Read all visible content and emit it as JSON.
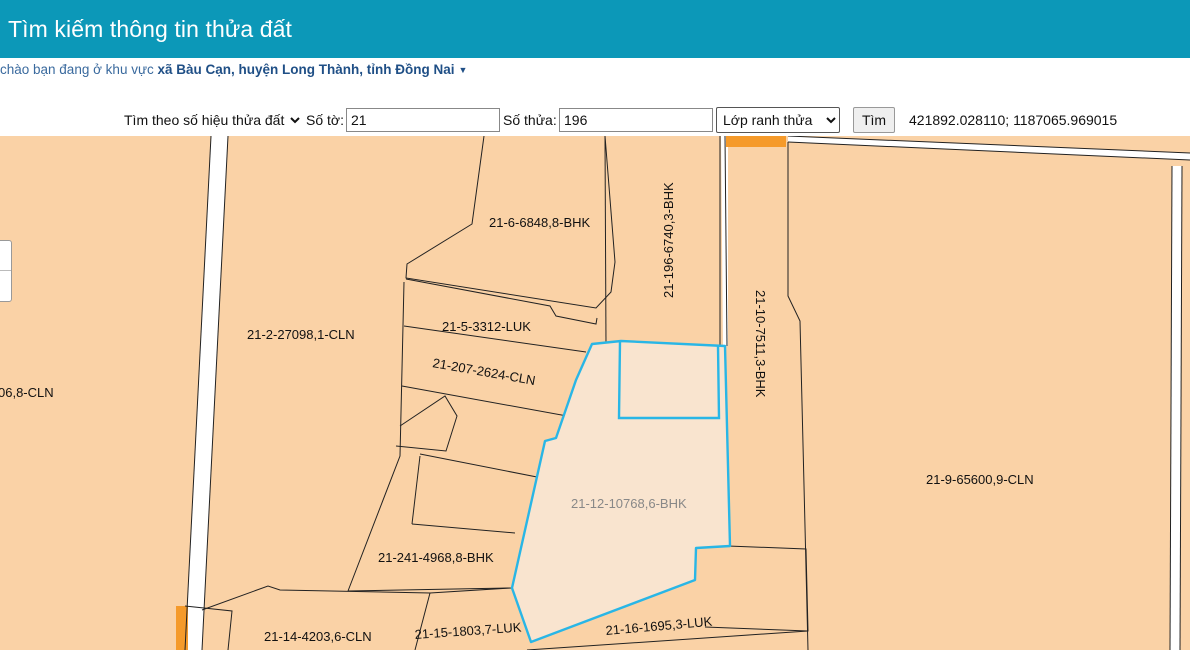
{
  "header": {
    "title": "Tìm kiếm thông tin thửa đất"
  },
  "greeting": {
    "prefix": "chào bạn đang ở khu vực ",
    "area": "xã Bàu Cạn, huyện Long Thành, tỉnh Đồng Nai"
  },
  "search": {
    "mode_options": [
      "Tìm theo số hiệu thửa đất"
    ],
    "sheet_label": "Số tờ:",
    "sheet_value": "21",
    "parcel_label": "Số thửa:",
    "parcel_value": "196",
    "layer_options": [
      "Lớp ranh thửa"
    ],
    "button_label": "Tìm",
    "coords": "421892.028110; 1187065.969015"
  },
  "map": {
    "parcel_labels": [
      "21-6-6848,8-BHK",
      "21-196-6740,3-BHK",
      "21-10-7511,3-BHK",
      "21-9-65600,9-CLN",
      "21-2-27098,1-CLN",
      "21-5-3312-LUK",
      "21-207-2624-CLN",
      "21-12-10768,6-BHK",
      "21-241-4968,8-BHK",
      "21-14-4203,6-CLN",
      "21-15-1803,7-LUK",
      "21-16-1695,3-LUK",
      "06,8-CLN"
    ],
    "colors": {
      "parcel_fill": "#fad2a6",
      "selected_fill": "#f9e4cf",
      "selected_outline": "#29b6e6",
      "road_fill": "#ffffff",
      "highlight_orange": "#f59a2a"
    }
  }
}
